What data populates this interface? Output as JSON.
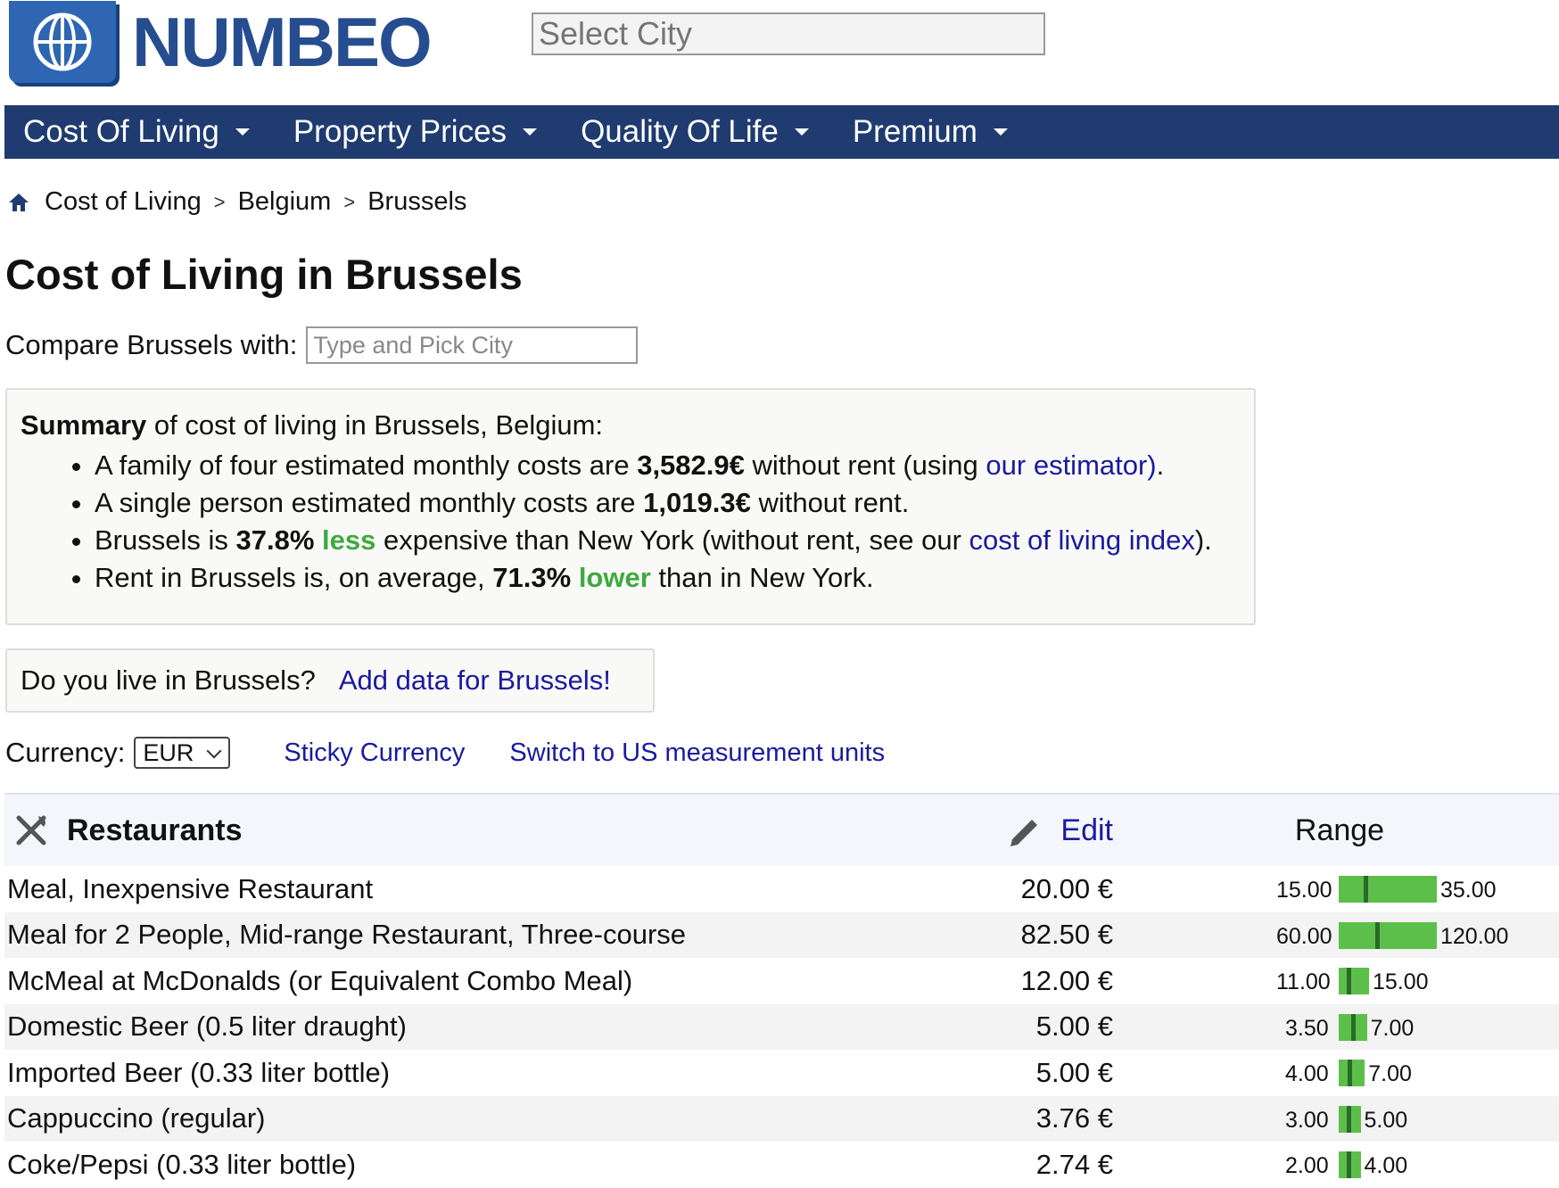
{
  "header": {
    "logo_text": "NUMBEO",
    "select_city_placeholder": "Select City"
  },
  "nav": [
    {
      "label": "Cost Of Living"
    },
    {
      "label": "Property Prices"
    },
    {
      "label": "Quality Of Life"
    },
    {
      "label": "Premium"
    }
  ],
  "breadcrumb": [
    {
      "label": "Cost of Living"
    },
    {
      "label": "Belgium"
    },
    {
      "label": "Brussels"
    }
  ],
  "breadcrumb_separator": ">",
  "page_title": "Cost of Living in Brussels",
  "compare": {
    "label": "Compare Brussels with:",
    "placeholder": "Type and Pick City"
  },
  "summary": {
    "heading_bold": "Summary",
    "heading_rest": " of cost of living in Brussels, Belgium:",
    "family_pre": "A family of four estimated monthly costs are ",
    "family_value": "3,582.9€",
    "family_mid": " without rent (using ",
    "family_link": "our estimator)",
    "family_end": ".",
    "single_pre": "A single person estimated monthly costs are ",
    "single_value": "1,019.3€",
    "single_end": " without rent.",
    "compare_pre": "Brussels is ",
    "compare_value": "37.8%",
    "compare_word": "less",
    "compare_mid": " expensive than New York (without rent, see our ",
    "compare_link": "cost of living index",
    "compare_end": ").",
    "rent_pre": "Rent in Brussels is, on average, ",
    "rent_value": "71.3%",
    "rent_word": "lower",
    "rent_end": " than in New York."
  },
  "live_box": {
    "question": "Do you live in Brussels?",
    "link": "Add data for Brussels!"
  },
  "currency": {
    "label": "Currency:",
    "selected": "EUR",
    "sticky_link": "Sticky Currency",
    "units_link": "Switch to US measurement units"
  },
  "table": {
    "section_title": "Restaurants",
    "edit_label": "Edit",
    "range_label": "Range",
    "rows": [
      {
        "name": "Meal, Inexpensive Restaurant",
        "price": "20.00 €",
        "min": "15.00",
        "max": "35.00",
        "value": 20.0,
        "lo": 15.0,
        "hi": 35.0
      },
      {
        "name": "Meal for 2 People, Mid-range Restaurant, Three-course",
        "price": "82.50 €",
        "min": "60.00",
        "max": "120.00",
        "value": 82.5,
        "lo": 60.0,
        "hi": 120.0
      },
      {
        "name": "McMeal at McDonalds (or Equivalent Combo Meal)",
        "price": "12.00 €",
        "min": "11.00",
        "max": "15.00",
        "value": 12.0,
        "lo": 11.0,
        "hi": 15.0
      },
      {
        "name": "Domestic Beer (0.5 liter draught)",
        "price": "5.00 €",
        "min": "3.50",
        "max": "7.00",
        "value": 5.0,
        "lo": 3.5,
        "hi": 7.0
      },
      {
        "name": "Imported Beer (0.33 liter bottle)",
        "price": "5.00 €",
        "min": "4.00",
        "max": "7.00",
        "value": 5.0,
        "lo": 4.0,
        "hi": 7.0
      },
      {
        "name": "Cappuccino (regular)",
        "price": "3.76 €",
        "min": "3.00",
        "max": "5.00",
        "value": 3.76,
        "lo": 3.0,
        "hi": 5.0
      },
      {
        "name": "Coke/Pepsi (0.33 liter bottle)",
        "price": "2.74 €",
        "min": "2.00",
        "max": "4.00",
        "value": 2.74,
        "lo": 2.0,
        "hi": 4.0
      }
    ]
  },
  "colors": {
    "nav_bg": "#1f3b6f",
    "link": "#1a1aa0",
    "green": "#3fa93f",
    "bar": "#5cbf49"
  }
}
